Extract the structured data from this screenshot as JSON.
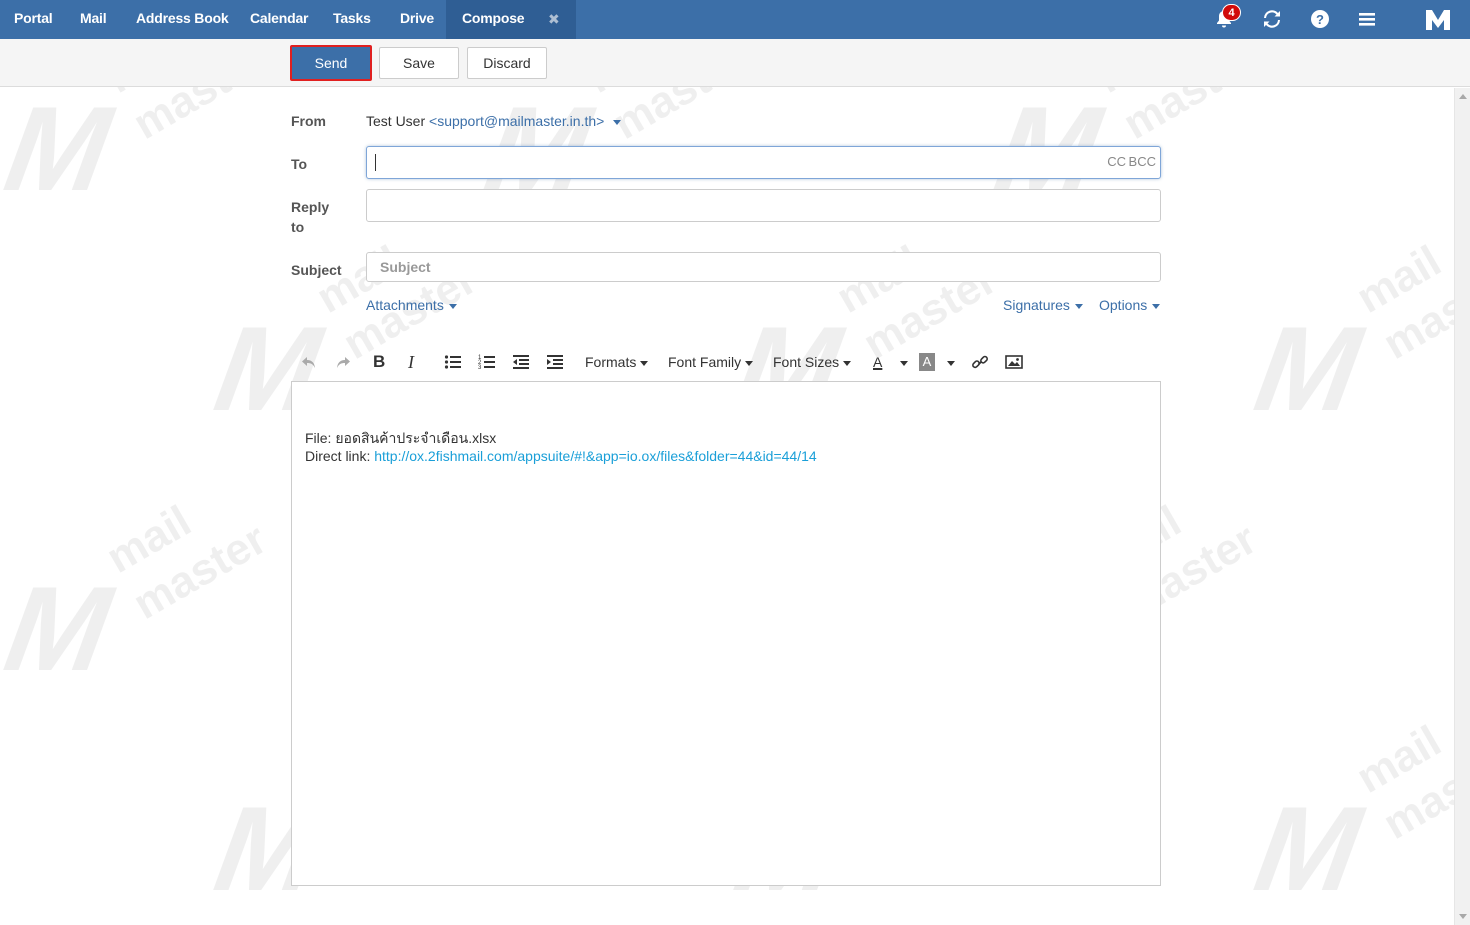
{
  "nav": {
    "tabs": [
      {
        "label": "Portal"
      },
      {
        "label": "Mail"
      },
      {
        "label": "Address Book"
      },
      {
        "label": "Calendar"
      },
      {
        "label": "Tasks"
      },
      {
        "label": "Drive"
      },
      {
        "label": "Compose",
        "active": true
      }
    ],
    "notifications_count": "4",
    "icons": [
      "bell-icon",
      "refresh-icon",
      "help-icon",
      "menu-icon",
      "logo-icon"
    ]
  },
  "toolbar": {
    "send_label": "Send",
    "save_label": "Save",
    "discard_label": "Discard"
  },
  "form": {
    "from_label": "From",
    "from_name": "Test User",
    "from_email": "<support@mailmaster.in.th>",
    "to_label": "To",
    "to_value": "",
    "cc_label": "CC",
    "bcc_label": "BCC",
    "reply_label_1": "Reply",
    "reply_label_2": "to",
    "reply_value": "",
    "subject_label": "Subject",
    "subject_placeholder": "Subject",
    "attachments_label": "Attachments",
    "signatures_label": "Signatures",
    "options_label": "Options"
  },
  "editor_toolbar": {
    "formats_label": "Formats",
    "font_family_label": "Font Family",
    "font_sizes_label": "Font Sizes",
    "font_color_glyph": "A",
    "bg_color_glyph": "A"
  },
  "editor": {
    "file_line": "File: ยอดสินค้าประจำเดือน.xlsx",
    "direct_link_prefix": "Direct link: ",
    "direct_link_url": "http://ox.2fishmail.com/appsuite/#!&app=io.ox/files&folder=44&id=44/14"
  },
  "watermark": {
    "text_1": "mail",
    "text_2": "master"
  },
  "colors": {
    "topbar": "#3c6fa8",
    "active_tab": "#2f5e94",
    "link": "#3c6fa8",
    "editor_link": "#1a9fd8",
    "send_border": "#e02020",
    "badge": "#d10b0b"
  }
}
